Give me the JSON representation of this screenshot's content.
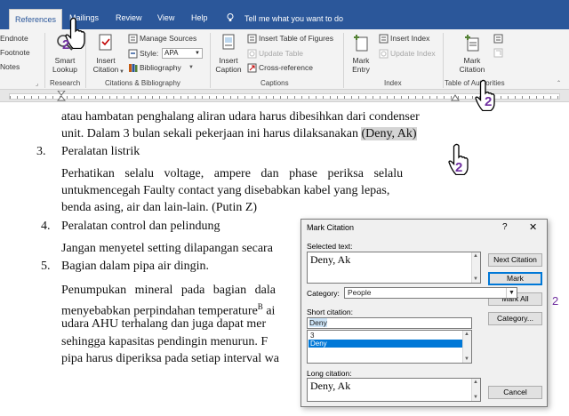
{
  "tabs": {
    "references": "References",
    "mailings": "Mailings",
    "review": "Review",
    "view": "View",
    "help": "Help",
    "tell_me": "Tell me what you want to do"
  },
  "ribbon": {
    "footnotes": {
      "endnote": "Endnote",
      "footnote": "Footnote",
      "notes": "Notes"
    },
    "research": {
      "smart_lookup_line1": "Smart",
      "smart_lookup_line2": "Lookup",
      "group_label": "Research"
    },
    "citations": {
      "insert_citation_line1": "Insert",
      "insert_citation_line2": "Citation",
      "manage_sources": "Manage Sources",
      "style_label": "Style:",
      "style_value": "APA",
      "bibliography": "Bibliography",
      "group_label": "Citations & Bibliography"
    },
    "captions": {
      "insert_caption_line1": "Insert",
      "insert_caption_line2": "Caption",
      "insert_table_of_figures": "Insert Table of Figures",
      "update_table": "Update Table",
      "cross_reference": "Cross-reference",
      "group_label": "Captions"
    },
    "index": {
      "mark_entry_line1": "Mark",
      "mark_entry_line2": "Entry",
      "insert_index": "Insert Index",
      "update_index": "Update Index",
      "group_label": "Index"
    },
    "toa": {
      "mark_citation_line1": "Mark",
      "mark_citation_line2": "Citation",
      "group_label": "Table of Authorities"
    }
  },
  "document": {
    "l1": "atau hambatan penghalang aliran udara harus dibesihkan dari condenser",
    "l2_pre": "unit. Dalam 3 bulan sekali pekerjaan ini harus dilaksanakan ",
    "l2_hl": "(Deny, Ak)",
    "n3": "3.",
    "h3": "Peralatan listrik",
    "l3": "Perhatikan selalu voltage, ampere dan phase periksa selalu",
    "l4": "untukmencegah Faulty contact yang disebabkan kabel yang lepas,",
    "l5": "benda asing, air dan lain-lain. (Putin Z)",
    "n4": "4.",
    "h4": "Peralatan control dan pelindung",
    "l6": "Jangan menyetel setting dilapangan secara",
    "n5": "5.",
    "h5": "Bagian dalam pipa air dingin.",
    "l7": "Penumpukan mineral pada bagian dala",
    "l8_pre": "menyebabkan perpindahan temperature",
    "l8_sup": "B",
    "l8_post": " ai",
    "l9": "udara AHU terhalang dan juga dapat mer",
    "l10": "sehingga kapasitas pendingin menurun. F",
    "l11": "pipa harus diperiksa pada setiap interval wa"
  },
  "dialog": {
    "title": "Mark Citation",
    "help": "?",
    "close": "✕",
    "selected_text_label": "Selected text:",
    "selected_text_value": "Deny, Ak",
    "category_label": "Category:",
    "category_value": "People",
    "short_citation_label": "Short citation:",
    "short_citation_value": "Deny",
    "short_list": [
      "3",
      "Deny"
    ],
    "long_citation_label": "Long citation:",
    "long_citation_value": "Deny, Ak",
    "buttons": {
      "next_citation": "Next Citation",
      "mark": "Mark",
      "mark_all": "Mark All",
      "category": "Category...",
      "cancel": "Cancel"
    }
  },
  "annotations": {
    "step_tab": "2",
    "step_mark_citation": "2",
    "step_selection": "2",
    "step_side": "2"
  },
  "colors": {
    "ribbon_blue": "#2b579a",
    "annotation_purple": "#7030a0",
    "selection_gray": "#d4d4d4",
    "list_selection": "#0078d7"
  }
}
